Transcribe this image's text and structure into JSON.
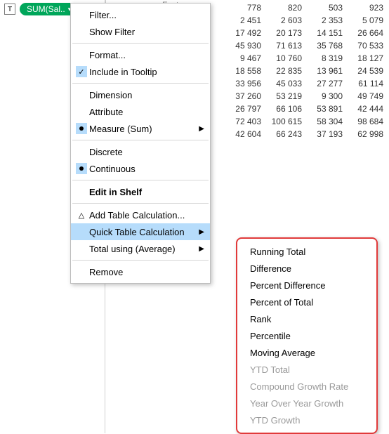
{
  "pill": {
    "type_icon": "T",
    "label": "SUM(Sal..",
    "caret": "▾"
  },
  "grid": {
    "header_partial": "Fasteners",
    "rows": [
      [
        "778",
        "820",
        "503",
        "923"
      ],
      [
        "2 451",
        "2 603",
        "2 353",
        "5 079"
      ],
      [
        "17 492",
        "20 173",
        "14 151",
        "26 664"
      ],
      [
        "45 930",
        "71 613",
        "35 768",
        "70 533"
      ],
      [
        "9 467",
        "10 760",
        "8 319",
        "18 127"
      ],
      [
        "18 558",
        "22 835",
        "13 961",
        "24 539"
      ],
      [
        "33 956",
        "45 033",
        "27 277",
        "61 114"
      ],
      [
        "37 260",
        "53 219",
        "9 300",
        "49 749"
      ],
      [
        "26 797",
        "66 106",
        "53 891",
        "42 444"
      ],
      [
        "72 403",
        "100 615",
        "58 304",
        "98 684"
      ],
      [
        "42 604",
        "66 243",
        "37 193",
        "62 998"
      ]
    ]
  },
  "menu": {
    "filter": "Filter...",
    "show_filter": "Show Filter",
    "format": "Format...",
    "include_tooltip": "Include in Tooltip",
    "dimension": "Dimension",
    "attribute": "Attribute",
    "measure": "Measure (Sum)",
    "discrete": "Discrete",
    "continuous": "Continuous",
    "edit_shelf": "Edit in Shelf",
    "add_table_calc": "Add Table Calculation...",
    "quick_table_calc": "Quick Table Calculation",
    "total_using": "Total using (Average)",
    "remove": "Remove"
  },
  "submenu": {
    "running_total": "Running Total",
    "difference": "Difference",
    "percent_difference": "Percent Difference",
    "percent_of_total": "Percent of Total",
    "rank": "Rank",
    "percentile": "Percentile",
    "moving_average": "Moving Average",
    "ytd_total": "YTD Total",
    "compound_growth": "Compound Growth Rate",
    "yoy_growth": "Year Over Year Growth",
    "ytd_growth": "YTD Growth"
  },
  "glyphs": {
    "check": "✓",
    "triangle": "△",
    "arrow": "▶"
  }
}
